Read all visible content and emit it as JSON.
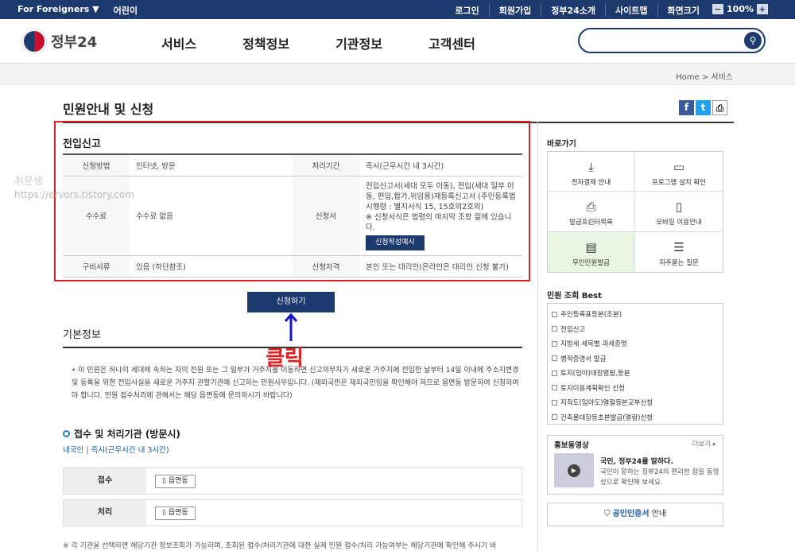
{
  "topbar": {
    "foreigners": "For Foreigners ▼",
    "kids": "어린이",
    "links": [
      "로그인",
      "회원가입",
      "정부24소개",
      "사이트맵",
      "화면크기"
    ],
    "zoom": "100%",
    "minus": "−",
    "plus": "+"
  },
  "header": {
    "logo": "정부24",
    "nav": [
      "서비스",
      "정책정보",
      "기관정보",
      "고객센터"
    ],
    "search_icon": "search-icon"
  },
  "breadcrumb": "Home > 서비스",
  "title": "민원안내 및 신청",
  "share": {
    "fb": "f",
    "tw": "t",
    "print": "⎙"
  },
  "section1": {
    "heading": "전입신고",
    "rows": {
      "method_label": "신청방법",
      "method": "인터넷, 방문",
      "period_label": "처리기간",
      "period": "즉시(근무시간 내 3시간)",
      "fee_label": "수수료",
      "fee": "수수료 없음",
      "form_label": "신청서",
      "form_text": "전입신고서(세대 모두 이동), 전입(세대 일부 이동, 편입,합가,위임용)재등록신고서 (주민등록법 시행령 : 별지서식 15, 15호의2호의)",
      "form_note": "※ 신청서식은 법령의 마지막 조항 밑에 있습니다.",
      "form_example": "신청작성예시",
      "docs_label": "구비서류",
      "docs": "있음 (하단참조)",
      "qual_label": "신청자격",
      "qual": "본인 또는 대리인(온라인은 대리인 신청 불가)"
    }
  },
  "apply_button": "신청하기",
  "click_text": "클릭",
  "watermark": {
    "line1": "취운생",
    "line2": "https://ervors.tistory.com"
  },
  "basic": {
    "heading": "기본정보",
    "text": "• 이 민원은 하나의 세대에 속하는 자의 전원 또는 그 일부가 거주지를 이동하면 신고의무자가 새로운 거주지에 전입한 날부터 14일 이내에 주소지변경 및 등록을 위한 전입사실을 새로운 거주지 관할기관에 신고하는 민원사무입니다. (재외국민은 재외국민임을 확인해야 하므로 읍면동 방문하여 신청하여야 합니다. 민원 접수처리에 관해서는 해당 읍면동에 문의하시기 바랍니다)"
  },
  "process": {
    "heading": "접수 및 처리기관 (방문시)",
    "sub": "내국인 | 즉시(근무시간 내 3시간)",
    "rows": [
      {
        "label": "접수",
        "btn": "읍면동"
      },
      {
        "label": "처리",
        "btn": "읍면동"
      }
    ],
    "note": "※ 각 기관을 선택하면 해당기관 정보조회가 가능하며, 조회된 접수/처리기관에 대한 실제 민원 접수/처리 가능여부는 해당기관에 확인해 주시기 바"
  },
  "sidebar": {
    "quick_title": "바로가기",
    "quick": [
      {
        "label": "전자결제 안내",
        "icon": "download-icon"
      },
      {
        "label": "프로그램 설치 확인",
        "icon": "monitor-icon"
      },
      {
        "label": "발급프린터목록",
        "icon": "printer-icon"
      },
      {
        "label": "모바일 이용안내",
        "icon": "mobile-icon"
      },
      {
        "label": "무인민원발급",
        "icon": "kiosk-icon"
      },
      {
        "label": "자주묻는 질문",
        "icon": "faq-icon"
      }
    ],
    "best_title": "민원 조회 Best",
    "best": [
      "주민등록표등본(조본)",
      "전입신고",
      "지방세 세목별 과세증명",
      "병적증명서 발급",
      "토지(임야)대장열람,등본",
      "토지이용계획확인 신청",
      "지적도(임야도)열람등본교부신청",
      "건축물대장등초본발급(열람)신청"
    ],
    "promo": {
      "title": "홍보동영상",
      "more": "더보기 ▸",
      "headline": "국민, 정부24를 말하다.",
      "desc": "국민이 말하는 정부24의 편리한 점을 동영상으로 확인해 보세요."
    },
    "cert": {
      "a": "공인인증서",
      "b": " 안내"
    }
  }
}
